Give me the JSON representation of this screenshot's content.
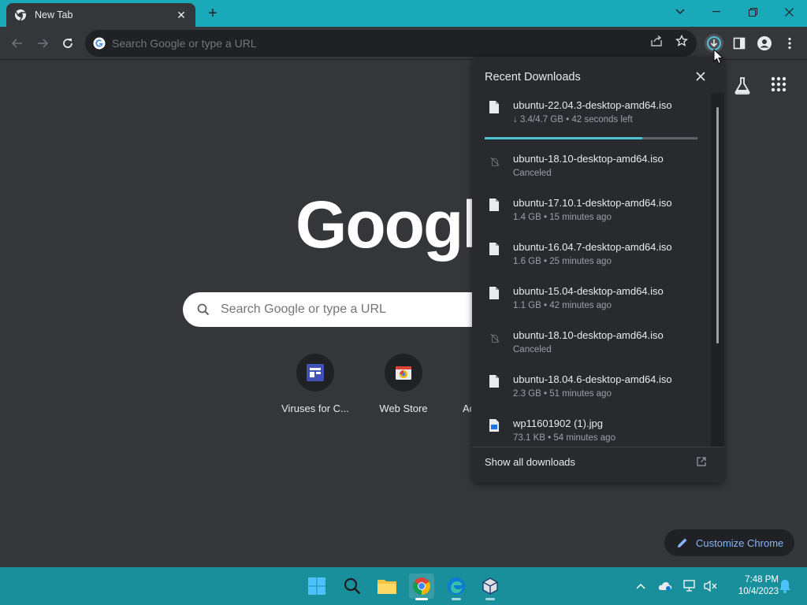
{
  "browser": {
    "tab_title": "New Tab",
    "omnibox_placeholder": "Search Google or type a URL"
  },
  "ntp": {
    "logo_text": "Googl",
    "search_placeholder": "Search Google or type a URL",
    "shortcuts": [
      {
        "label": "Viruses for C..."
      },
      {
        "label": "Web Store"
      },
      {
        "label": "Ac"
      }
    ],
    "customize_label": "Customize Chrome"
  },
  "downloads": {
    "title": "Recent Downloads",
    "items": [
      {
        "name": "ubuntu-22.04.3-desktop-amd64.iso",
        "status": "↓ 3.4/4.7 GB • 42 seconds left",
        "state": "in_progress",
        "progress": 0.74
      },
      {
        "name": "ubuntu-18.10-desktop-amd64.iso",
        "status": "Canceled",
        "state": "canceled"
      },
      {
        "name": "ubuntu-17.10.1-desktop-amd64.iso",
        "status": "1.4 GB • 15 minutes ago",
        "state": "complete"
      },
      {
        "name": "ubuntu-16.04.7-desktop-amd64.iso",
        "status": "1.6 GB • 25 minutes ago",
        "state": "complete"
      },
      {
        "name": "ubuntu-15.04-desktop-amd64.iso",
        "status": "1.1 GB • 42 minutes ago",
        "state": "complete"
      },
      {
        "name": "ubuntu-18.10-desktop-amd64.iso",
        "status": "Canceled",
        "state": "canceled"
      },
      {
        "name": "ubuntu-18.04.6-desktop-amd64.iso",
        "status": "2.3 GB • 51 minutes ago",
        "state": "complete"
      },
      {
        "name": "wp11601902 (1).jpg",
        "status": "73.1 KB • 54 minutes ago",
        "state": "complete_image"
      }
    ],
    "show_all_label": "Show all downloads"
  },
  "taskbar": {
    "time": "7:48 PM",
    "date": "10/4/2023"
  },
  "colors": {
    "titlebar": "#1aa9b8",
    "taskbar": "#1a8f9c",
    "progress": "#4ec3d3",
    "accent_link": "#8ab4f8"
  }
}
